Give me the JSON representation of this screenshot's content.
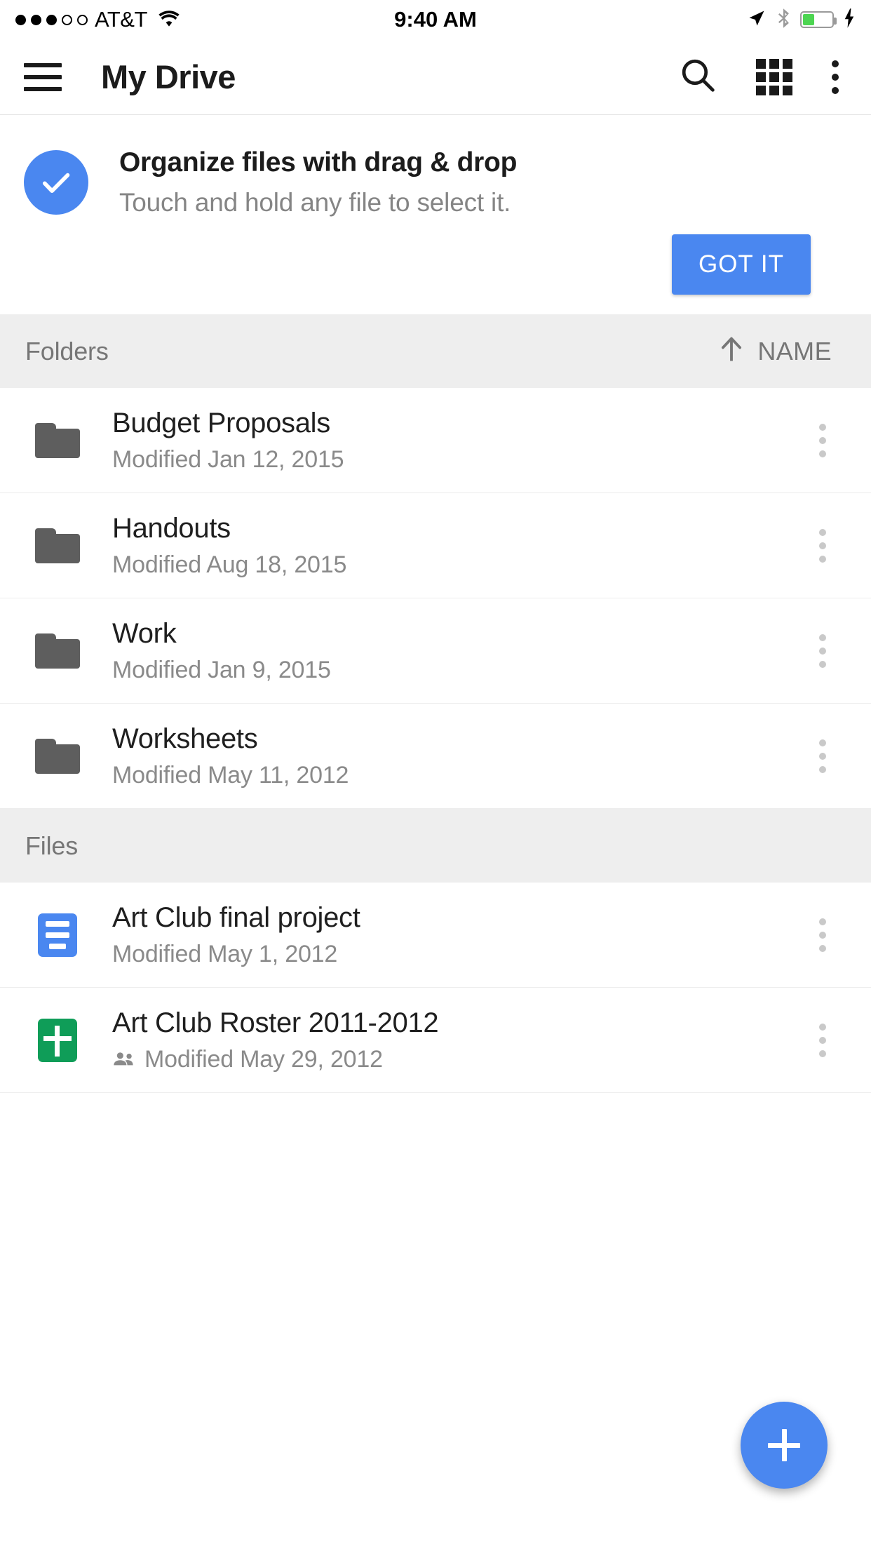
{
  "status_bar": {
    "signal_dots_filled": 3,
    "signal_dots_empty": 2,
    "carrier": "AT&T",
    "wifi_icon": "wifi-icon",
    "time": "9:40 AM",
    "location_icon": "location-arrow-icon",
    "bluetooth_icon": "bluetooth-icon",
    "battery_icon": "battery-icon",
    "battery_level_percent": 40,
    "battery_color": "#4cd551",
    "charging_icon": "lightning-bolt-icon"
  },
  "app_bar": {
    "menu_icon": "hamburger-menu-icon",
    "title": "My Drive",
    "search_icon": "search-icon",
    "grid_view_icon": "grid-view-icon",
    "overflow_icon": "overflow-menu-icon"
  },
  "promo": {
    "check_icon": "check-circle-icon",
    "title": "Organize files with drag & drop",
    "subtitle": "Touch and hold any file to select it.",
    "button_label": "GOT IT",
    "accent_color": "#4a87f0"
  },
  "folders_section": {
    "label": "Folders",
    "sort_arrow_icon": "arrow-up-icon",
    "sort_label": "NAME"
  },
  "folders": [
    {
      "icon": "folder-icon",
      "name": "Budget Proposals",
      "modified": "Modified Jan 12, 2015",
      "overflow_icon": "overflow-menu-icon"
    },
    {
      "icon": "folder-icon",
      "name": "Handouts",
      "modified": "Modified Aug 18, 2015",
      "overflow_icon": "overflow-menu-icon"
    },
    {
      "icon": "folder-icon",
      "name": "Work",
      "modified": "Modified Jan 9, 2015",
      "overflow_icon": "overflow-menu-icon"
    },
    {
      "icon": "folder-icon",
      "name": "Worksheets",
      "modified": "Modified May 11, 2012",
      "overflow_icon": "overflow-menu-icon"
    }
  ],
  "files_section": {
    "label": "Files"
  },
  "files": [
    {
      "icon": "google-docs-icon",
      "icon_color": "#4a87f0",
      "name": "Art Club final project",
      "modified": "Modified May 1, 2012",
      "shared": false,
      "overflow_icon": "overflow-menu-icon"
    },
    {
      "icon": "google-sheets-icon",
      "icon_color": "#0f9d58",
      "name": "Art Club Roster 2011-2012",
      "modified": "Modified May 29, 2012",
      "shared": true,
      "shared_icon": "people-shared-icon",
      "overflow_icon": "overflow-menu-icon"
    }
  ],
  "fab": {
    "icon": "plus-icon",
    "color": "#4a87f0"
  }
}
